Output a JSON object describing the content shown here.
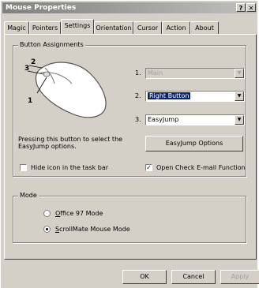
{
  "window": {
    "title": "Mouse Properties",
    "help": "?"
  },
  "tabs": [
    {
      "label": "Magic"
    },
    {
      "label": "Pointers"
    },
    {
      "label": "Settings"
    },
    {
      "label": "Orientation"
    },
    {
      "label": "Cursor"
    },
    {
      "label": "Action"
    },
    {
      "label": "About"
    }
  ],
  "button_assignments": {
    "title": "Button  Assignments",
    "callouts": [
      "1",
      "2",
      "3"
    ],
    "rows": [
      {
        "num": "1.",
        "value": "Main"
      },
      {
        "num": "2.",
        "value": "Right Button"
      },
      {
        "num": "3.",
        "value": "EasyJump"
      }
    ],
    "hint_line1": "Pressing this button to select the",
    "hint_line2": "EasyJump options.",
    "options_button": "EasyJump Options",
    "hide_icon": "Hide icon in the task bar",
    "open_email": "Open Check E-mail Function",
    "open_email_check": "✓"
  },
  "mode": {
    "title": "Mode",
    "option1_first": "O",
    "option1_rest": "ffice 97 Mode",
    "option2_first": "S",
    "option2_rest": "crollMate Mouse Mode"
  },
  "footer": {
    "ok": "OK",
    "cancel": "Cancel",
    "apply": "Apply"
  }
}
